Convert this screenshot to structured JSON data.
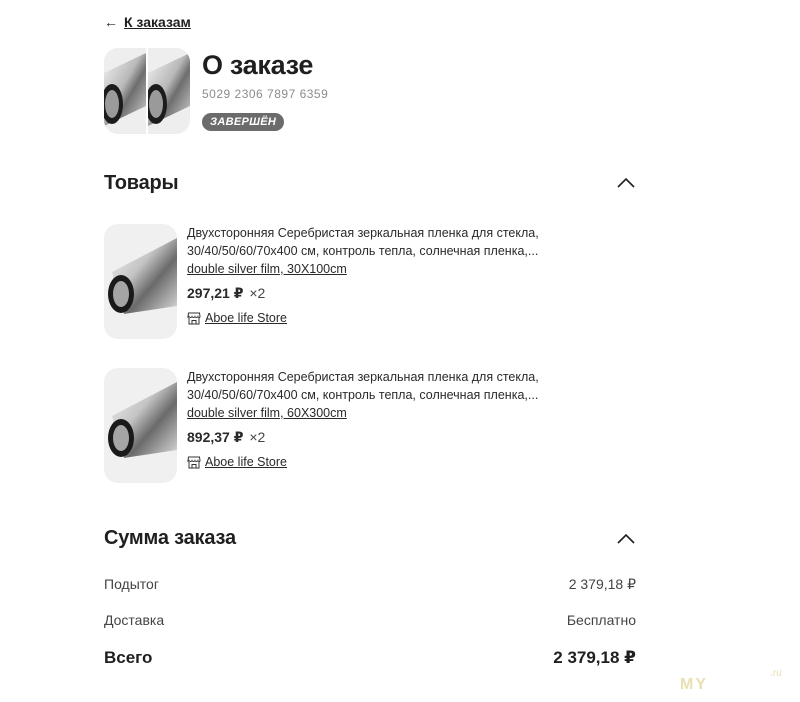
{
  "back": {
    "arrow": "←",
    "label": "К заказам"
  },
  "header": {
    "title": "О заказе",
    "order_number": "5029 2306 7897 6359",
    "status": "ЗАВЕРШЁН"
  },
  "products_section": {
    "title": "Товары",
    "items": [
      {
        "name": "Двухсторонняя Серебристая зеркальная пленка для стекла, 30/40/50/60/70x400 см, контроль тепла, солнечная пленка,...",
        "variant": "double silver film, 30X100cm",
        "price": "297,21 ₽",
        "qty": "×2",
        "store": "Aboe life Store"
      },
      {
        "name": "Двухсторонняя Серебристая зеркальная пленка для стекла, 30/40/50/60/70x400 см, контроль тепла, солнечная пленка,...",
        "variant": "double silver film, 60X300cm",
        "price": "892,37 ₽",
        "qty": "×2",
        "store": "Aboe life Store"
      }
    ]
  },
  "summary": {
    "title": "Сумма заказа",
    "subtotal_label": "Подытог",
    "subtotal_value": "2 379,18 ₽",
    "delivery_label": "Доставка",
    "delivery_value": "Бесплатно",
    "total_label": "Всего",
    "total_value": "2 379,18 ₽"
  },
  "watermark": {
    "text": "MY",
    "suffix": ".ru"
  },
  "icons": {
    "back": "arrow-left-icon",
    "collapse": "chevron-up-icon",
    "store": "store-icon"
  }
}
